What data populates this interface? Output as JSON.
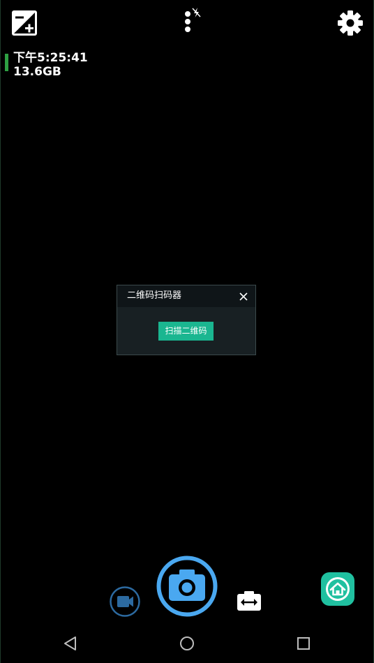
{
  "status": {
    "time": "下午5:25:41",
    "storage": "13.6GB"
  },
  "dialog": {
    "title": "二维码扫码器",
    "scan_button_label": "扫描二维码"
  },
  "icons": {
    "exposure": "exposure-icon",
    "more": "more-vertical-icon",
    "flash_off": "flash-off-icon",
    "settings": "gear-icon",
    "close": "close-icon",
    "video": "video-camera-icon",
    "shutter": "camera-icon",
    "switch_camera": "switch-camera-icon",
    "home_app": "home-icon",
    "nav_back": "triangle-back-icon",
    "nav_home": "circle-home-icon",
    "nav_recents": "square-recents-icon"
  },
  "colors": {
    "background": "#000000",
    "accent_green": "#2ea043",
    "scan_button": "#1ab690",
    "shutter_blue": "#4aa8f0",
    "video_blue": "#2c6aa0",
    "home_teal": "#20c0a0",
    "dialog_bg": "#182023",
    "dialog_header": "#0f1518"
  }
}
